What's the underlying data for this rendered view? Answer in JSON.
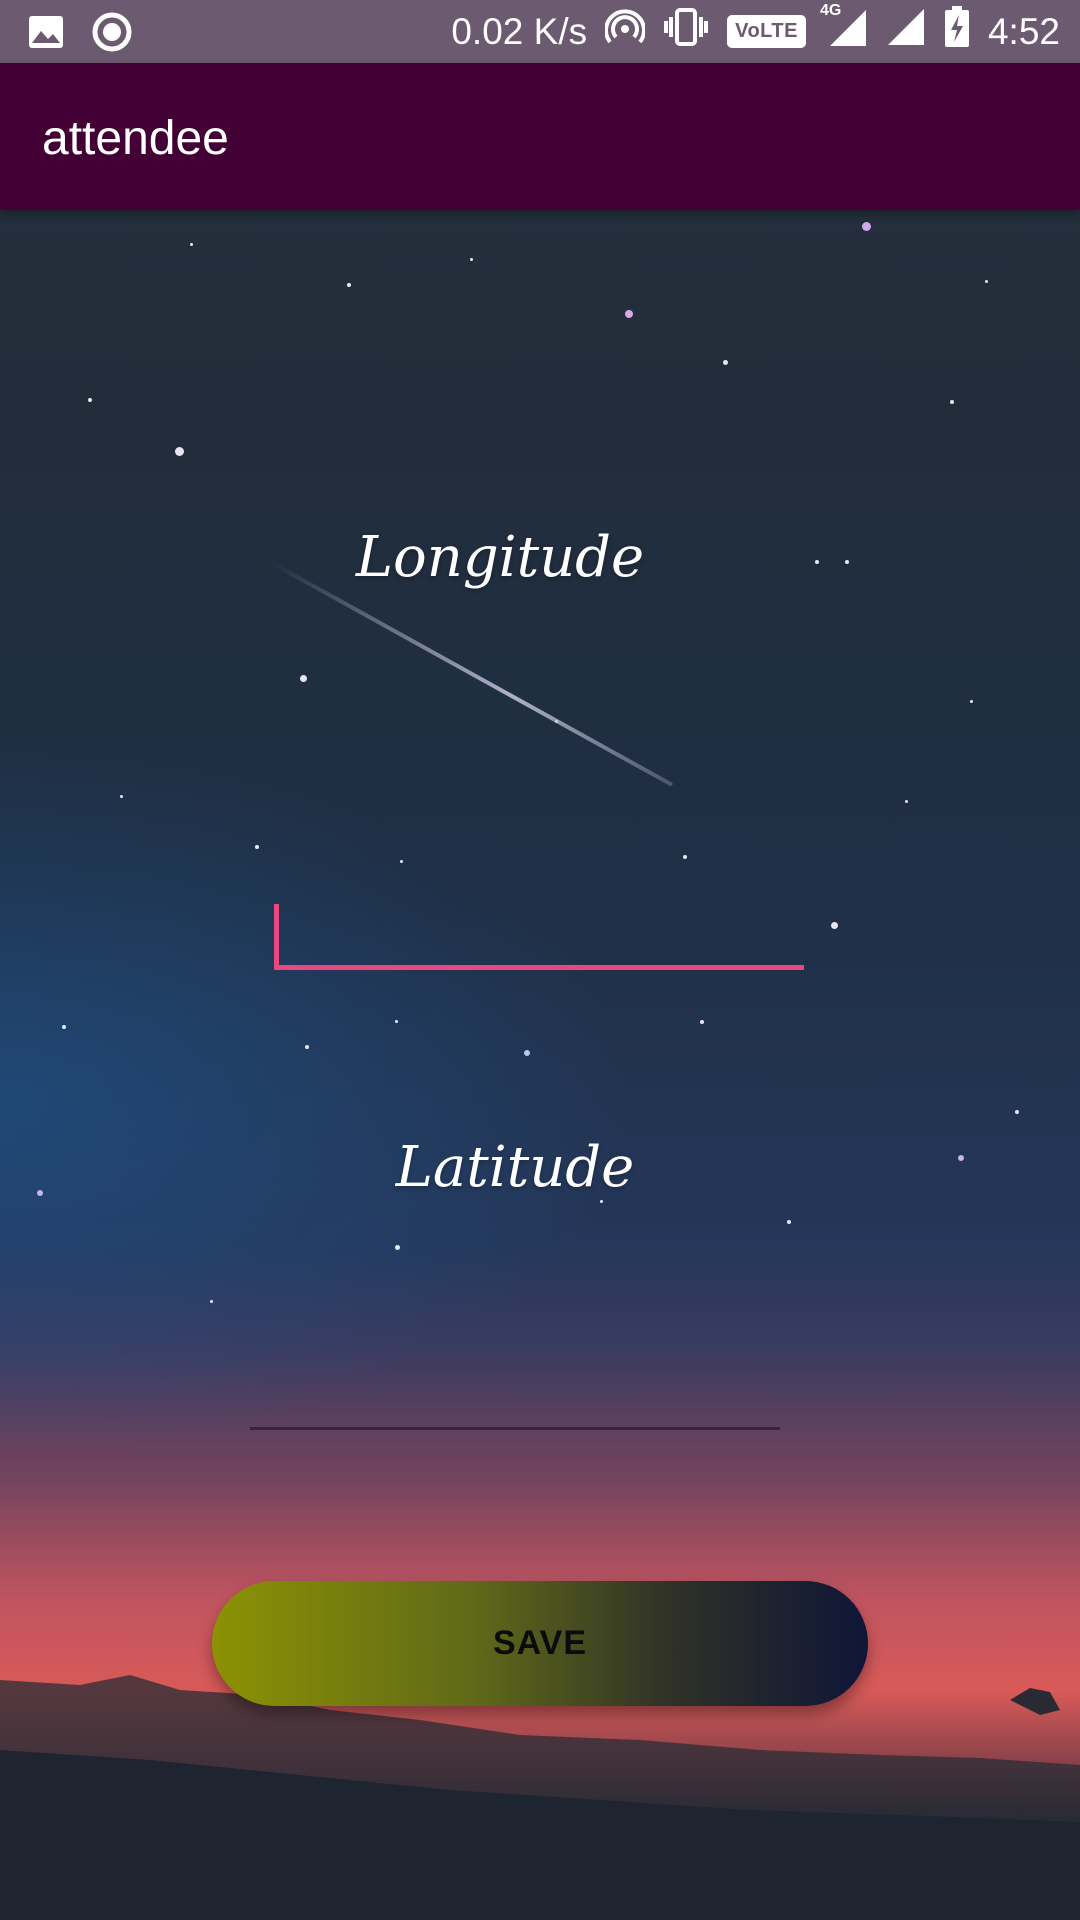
{
  "status_bar": {
    "network_speed": "0.02 K/s",
    "volte_label": "VoLTE",
    "network_type": "4G",
    "time": "4:52",
    "icons": [
      "gallery-icon",
      "record-icon",
      "hotspot-icon",
      "vibrate-icon",
      "volte-icon",
      "signal-4g-icon",
      "signal-icon",
      "battery-charging-icon"
    ]
  },
  "toolbar": {
    "title": "attendee",
    "background_color": "#430034"
  },
  "form": {
    "longitude_label": "Longitude",
    "longitude_value": "",
    "latitude_label": "Latitude",
    "latitude_value": "",
    "save_label": "SAVE",
    "active_underline_color": "#e94780"
  }
}
